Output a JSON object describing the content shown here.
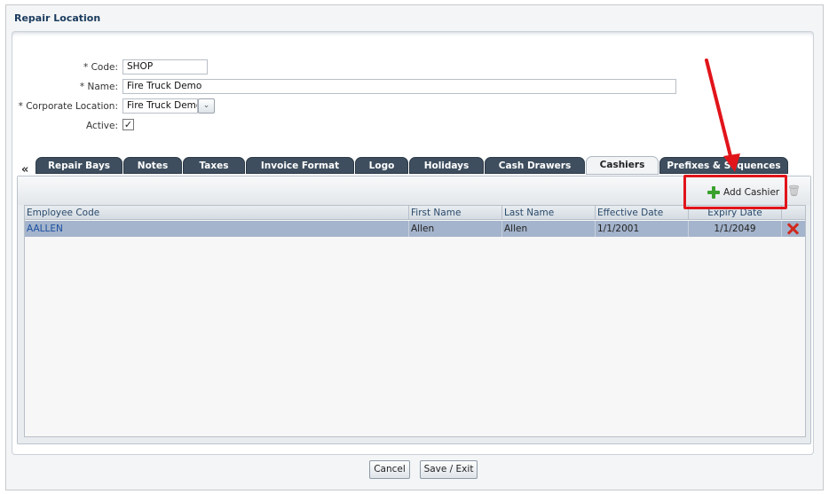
{
  "window": {
    "title": "Repair Location"
  },
  "form": {
    "code": {
      "label": "Code:",
      "required": "*",
      "value": "SHOP"
    },
    "name": {
      "label": "Name:",
      "required": "*",
      "value": "Fire Truck Demo"
    },
    "corporate_location": {
      "label": "Corporate Location:",
      "required": "*",
      "value": "Fire Truck Demo"
    },
    "active": {
      "label": "Active:",
      "checked": true,
      "check_glyph": "✓"
    }
  },
  "tabs": {
    "scroll_left": "«",
    "items": [
      "Repair Bays",
      "Notes",
      "Taxes",
      "Invoice Format",
      "Logo",
      "Holidays",
      "Cash Drawers",
      "Cashiers",
      "Prefixes & Sequences"
    ],
    "active": "Cashiers"
  },
  "toolbar": {
    "add_label": "Add Cashier"
  },
  "table": {
    "columns": [
      "Employee Code",
      "First Name",
      "Last Name",
      "Effective Date",
      "Expiry Date"
    ],
    "rows": [
      {
        "employee_code": "AALLEN",
        "first_name": "Allen",
        "last_name": "Allen",
        "effective_date": "1/1/2001",
        "expiry_date": "1/1/2049"
      }
    ]
  },
  "footer": {
    "cancel_label": "Cancel",
    "save_label": "Save / Exit"
  },
  "colors": {
    "accent_tab": "#3e4e5e",
    "selected_row": "#a4b4cc",
    "annotation": "#e1141a",
    "add_icon": "#3aa12d",
    "delete_icon": "#d0281d"
  }
}
